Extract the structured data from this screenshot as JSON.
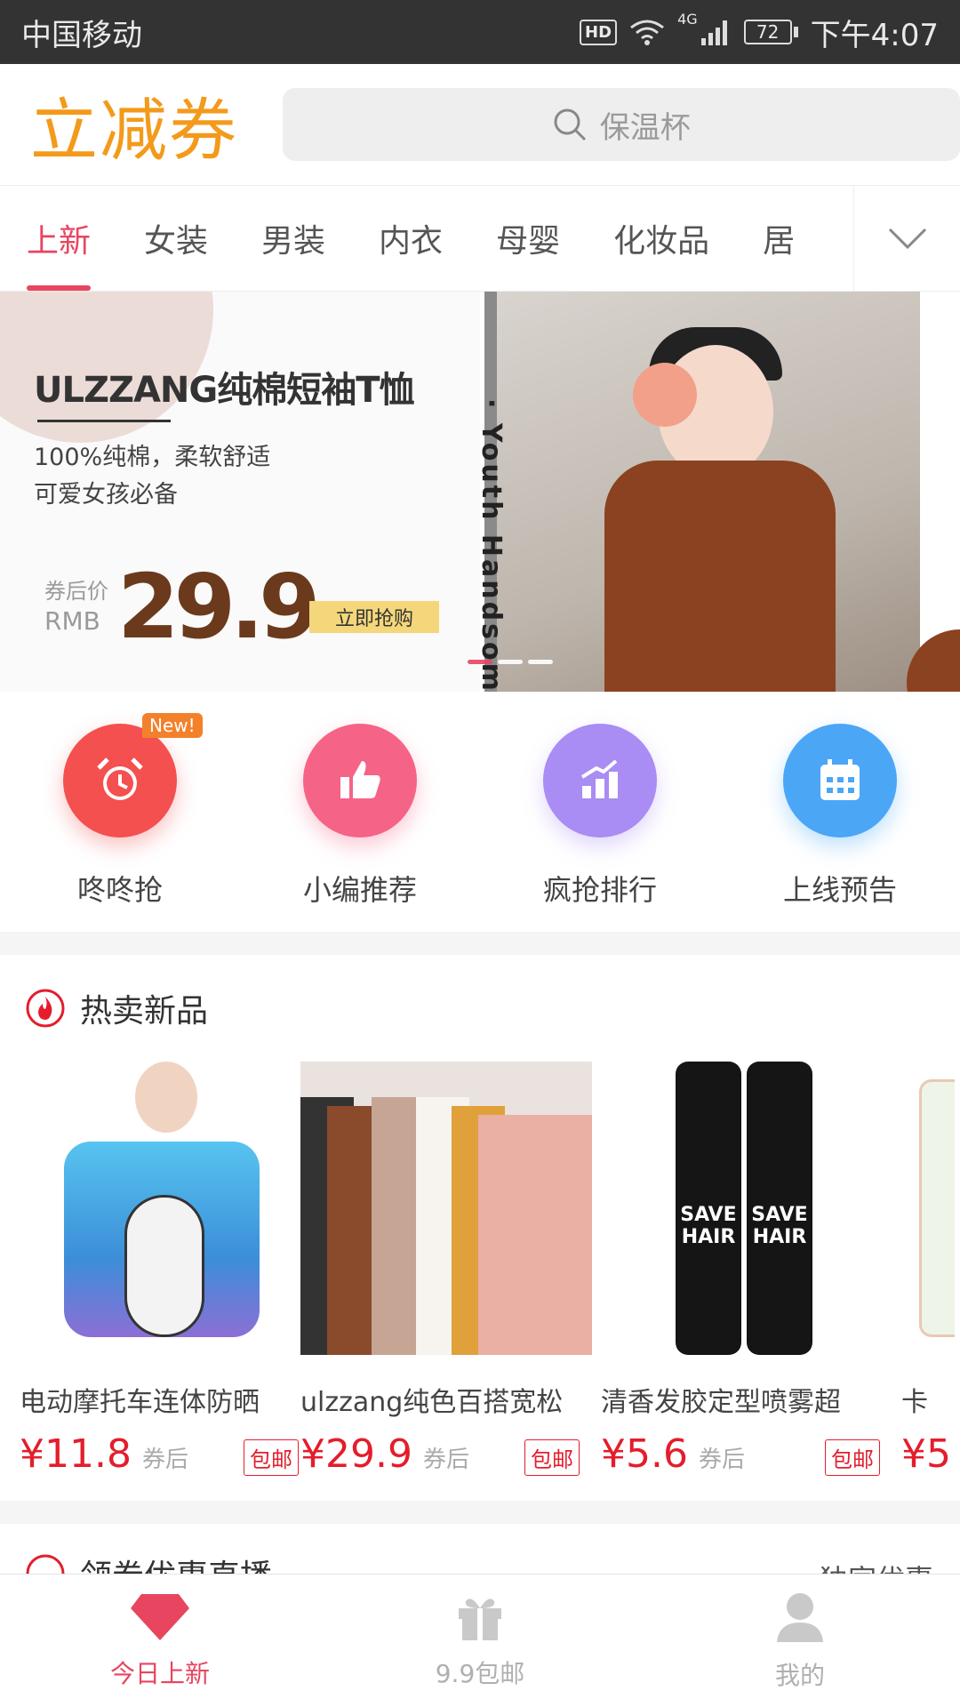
{
  "status_bar": {
    "carrier": "中国移动",
    "hd": "HD",
    "network": "4G",
    "battery": "72",
    "time": "下午4:07"
  },
  "header": {
    "logo": "立减券",
    "search_placeholder": "保温杯"
  },
  "tabs": [
    "上新",
    "女装",
    "男装",
    "内衣",
    "母婴",
    "化妆品",
    "居"
  ],
  "banner": {
    "title": "ULZZANG纯棉短袖T恤",
    "line1": "100%纯棉，柔软舒适",
    "line2": "可爱女孩必备",
    "after_label_1": "券后价",
    "after_label_2": "RMB",
    "price": "29.9",
    "button": "立即抢购",
    "vertical_text": "· Youth Handsome"
  },
  "quick": [
    {
      "label": "咚咚抢",
      "badge": "New!",
      "color": "#f4504f",
      "icon": "alarm-clock-icon"
    },
    {
      "label": "小编推荐",
      "color": "#f56387",
      "icon": "thumbs-up-icon"
    },
    {
      "label": "疯抢排行",
      "color": "#a98cf4",
      "icon": "rank-chart-icon"
    },
    {
      "label": "上线预告",
      "color": "#4ba6f6",
      "icon": "calendar-icon"
    }
  ],
  "hot": {
    "title": "热卖新品",
    "products": [
      {
        "name": "电动摩托车连体防晒",
        "price": "¥11.8",
        "after": "券后",
        "tag": "包邮"
      },
      {
        "name": "ulzzang纯色百搭宽松",
        "price": "¥29.9",
        "after": "券后",
        "tag": "包邮"
      },
      {
        "name": "清香发胶定型喷雾超",
        "price": "¥5.6",
        "after": "券后",
        "tag": "包邮"
      },
      {
        "name": "卡",
        "price": "¥5",
        "after": "",
        "tag": ""
      }
    ]
  },
  "next_section": {
    "title": "领券优惠直播",
    "right": "独家优惠"
  },
  "nav": [
    {
      "label": "今日上新",
      "icon": "diamond-icon"
    },
    {
      "label": "9.9包邮",
      "icon": "gift-icon"
    },
    {
      "label": "我的",
      "icon": "user-icon"
    }
  ],
  "colors": {
    "accent": "#e84560",
    "logo": "#f39a1b",
    "price": "#e41d2c"
  }
}
